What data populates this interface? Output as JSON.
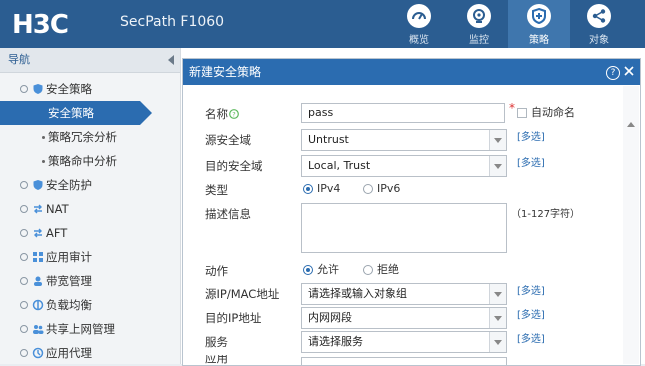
{
  "header": {
    "product": "SecPath F1060",
    "tabs": [
      {
        "label": "概览",
        "icon": "gauge-icon"
      },
      {
        "label": "监控",
        "icon": "monitor-icon"
      },
      {
        "label": "策略",
        "icon": "shield-icon"
      },
      {
        "label": "对象",
        "icon": "share-icon"
      }
    ],
    "active_tab": "策略",
    "colors": {
      "bar": "#2b5d91",
      "active": "#3f76ad"
    }
  },
  "sidebar": {
    "title": "导航",
    "items": [
      {
        "label": "安全策略"
      },
      {
        "label": "安全策略",
        "selected": true
      },
      {
        "label": "策略冗余分析"
      },
      {
        "label": "策略命中分析"
      },
      {
        "label": "安全防护"
      },
      {
        "label": "NAT"
      },
      {
        "label": "AFT"
      },
      {
        "label": "应用审计"
      },
      {
        "label": "带宽管理"
      },
      {
        "label": "负载均衡"
      },
      {
        "label": "共享上网管理"
      },
      {
        "label": "应用代理"
      }
    ]
  },
  "dialog": {
    "title": "新建安全策略",
    "name_label": "名称",
    "name_value": "pass",
    "auto_name_label": "自动命名",
    "src_zone_label": "源安全域",
    "src_zone_value": "Untrust",
    "dst_zone_label": "目的安全域",
    "dst_zone_value": "Local, Trust",
    "multi_link": "[多选]",
    "type_label": "类型",
    "ipv4_label": "IPv4",
    "ipv6_label": "IPv6",
    "desc_label": "描述信息",
    "desc_hint": "（1-127字符）",
    "action_label": "动作",
    "allow_label": "允许",
    "deny_label": "拒绝",
    "src_addr_label": "源IP/MAC地址",
    "src_addr_placeholder": "请选择或输入对象组",
    "dst_addr_label": "目的IP地址",
    "dst_addr_value": "内网网段",
    "service_label": "服务",
    "service_placeholder": "请选择服务",
    "partial_label": "应用"
  }
}
